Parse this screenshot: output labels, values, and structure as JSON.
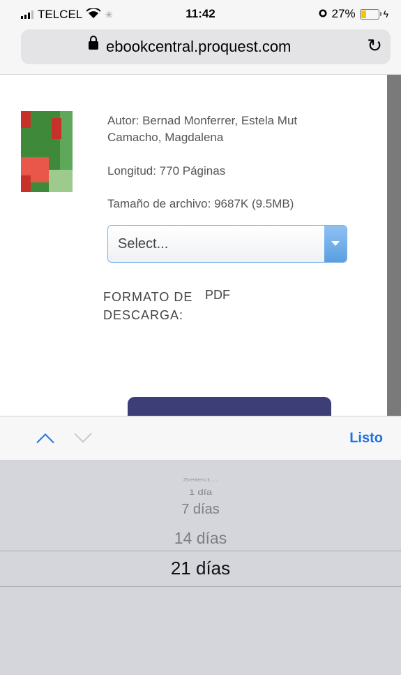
{
  "status_bar": {
    "carrier": "TELCEL",
    "time": "11:42",
    "battery_percent": "27%",
    "battery_level": 0.27
  },
  "browser": {
    "url": "ebookcentral.proquest.com"
  },
  "book": {
    "author": "Autor: Bernad Monferrer, Estela Mut Camacho, Magdalena",
    "length": "Longitud: 770 Páginas",
    "file_size": "Tamaño de archivo: 9687K (9.5MB)",
    "select_value": "Select...",
    "format_label": "FORMATO DE DESCARGA:",
    "format_value": "PDF"
  },
  "picker_toolbar": {
    "done_label": "Listo"
  },
  "picker": {
    "options": [
      "Select...",
      "1 día",
      "7 días",
      "14 días",
      "21 días"
    ],
    "selected": "21 días"
  },
  "colors": {
    "accent": "#1a73e8",
    "button": "#3d3d78",
    "battery": "#f7c600"
  }
}
